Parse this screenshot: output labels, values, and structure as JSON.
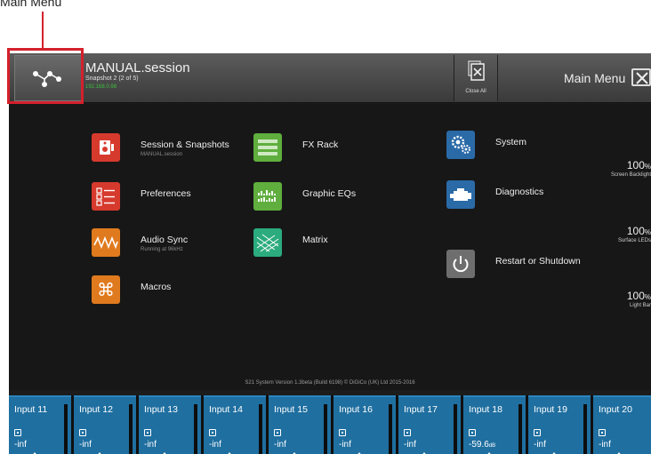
{
  "annotation": {
    "label": "Main Menu"
  },
  "header": {
    "session_name": "MANUAL.session",
    "snapshot": "Snapshot 2 (2 of 5)",
    "ip_address": "192.168.0.98",
    "close_all_label": "Close All",
    "title": "Main Menu"
  },
  "menu": {
    "session": {
      "label": "Session & Snapshots",
      "sub": "MANUAL.session",
      "color": "#d63a2d",
      "icon": "session-icon"
    },
    "preferences": {
      "label": "Preferences",
      "color": "#d63a2d",
      "icon": "checklist-icon"
    },
    "audio_sync": {
      "label": "Audio Sync",
      "sub": "Running at 96kHz",
      "color": "#e07a1e",
      "icon": "waveform-icon"
    },
    "macros": {
      "label": "Macros",
      "color": "#e07a1e",
      "icon": "command-key-icon"
    },
    "fx_rack": {
      "label": "FX Rack",
      "color": "#5fae3e",
      "icon": "fx-rack-icon"
    },
    "graphic_eqs": {
      "label": "Graphic EQs",
      "color": "#5fae3e",
      "icon": "graphic-eq-icon"
    },
    "matrix": {
      "label": "Matrix",
      "color": "#2bab7e",
      "icon": "matrix-grid-icon"
    },
    "system": {
      "label": "System",
      "color": "#2a6aa7",
      "icon": "gears-icon"
    },
    "diagnostics": {
      "label": "Diagnostics",
      "color": "#2a6aa7",
      "icon": "engine-icon"
    },
    "restart": {
      "label": "Restart or Shutdown",
      "color": "#6e6e6e",
      "icon": "power-icon"
    }
  },
  "levels": [
    {
      "value": "100",
      "unit": "%",
      "label": "Screen Backlight",
      "fraction": 1.0
    },
    {
      "value": "100",
      "unit": "%",
      "label": "Surface LEDs",
      "fraction": 1.0
    },
    {
      "value": "100",
      "unit": "%",
      "label": "Light Bar",
      "fraction": 1.0
    }
  ],
  "version": "S21 System Version 1.3beta (Build 6198) © DiGiCo (UK) Ltd 2015-2016",
  "strips": [
    {
      "name": "Input 11",
      "value": "-inf",
      "unit": ""
    },
    {
      "name": "Input 12",
      "value": "-inf",
      "unit": ""
    },
    {
      "name": "Input 13",
      "value": "-inf",
      "unit": ""
    },
    {
      "name": "Input 14",
      "value": "-inf",
      "unit": ""
    },
    {
      "name": "Input 15",
      "value": "-inf",
      "unit": ""
    },
    {
      "name": "Input 16",
      "value": "-inf",
      "unit": ""
    },
    {
      "name": "Input 17",
      "value": "-inf",
      "unit": ""
    },
    {
      "name": "Input 18",
      "value": "-59.6",
      "unit": "dB"
    },
    {
      "name": "Input 19",
      "value": "-inf",
      "unit": ""
    },
    {
      "name": "Input 20",
      "value": "-inf",
      "unit": ""
    }
  ],
  "colors": {
    "accent_red": "#d4202c",
    "strip_blue": "#1f6fa0",
    "ip_green": "#3fbf3f"
  }
}
